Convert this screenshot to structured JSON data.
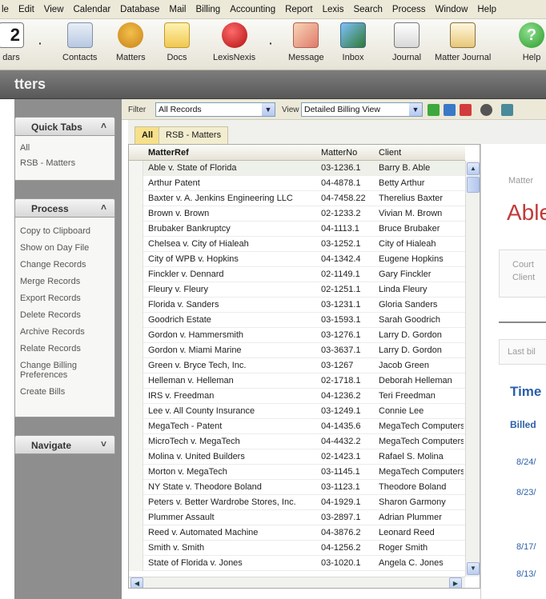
{
  "menu": [
    "le",
    "Edit",
    "View",
    "Calendar",
    "Database",
    "Mail",
    "Billing",
    "Accounting",
    "Report",
    "Lexis",
    "Search",
    "Process",
    "Window",
    "Help"
  ],
  "toolbar": {
    "calendar_label": "dars",
    "contacts_label": "Contacts",
    "matters_label": "Matters",
    "docs_label": "Docs",
    "lexisnexis_label": "LexisNexis",
    "message_label": "Message",
    "inbox_label": "Inbox",
    "journal_label": "Journal",
    "matter_journal_label": "Matter Journal",
    "help_label": "Help",
    "calendar_digit": "2"
  },
  "title": "tters",
  "quick_tabs": {
    "title": "Quick Tabs",
    "items": [
      "All",
      "RSB - Matters"
    ]
  },
  "process": {
    "title": "Process",
    "items": [
      "Copy to Clipboard",
      "Show on Day File",
      "Change Records",
      "Merge Records",
      "Export Records",
      "Delete Records",
      "Archive Records",
      "Relate Records",
      "Change Billing Preferences",
      "Create Bills"
    ]
  },
  "navigate": {
    "title": "Navigate"
  },
  "filter": {
    "filter_label": "Filter",
    "filter_value": "All Records",
    "view_label": "View",
    "view_value": "Detailed Billing View"
  },
  "tabs": [
    "All",
    "RSB - Matters"
  ],
  "grid": {
    "columns": [
      "MatterRef",
      "MatterNo",
      "Client"
    ],
    "rows": [
      [
        "Able v. State of Florida",
        "03-1236.1",
        "Barry B. Able"
      ],
      [
        "Arthur Patent",
        "04-4878.1",
        "Betty Arthur"
      ],
      [
        "Baxter v. A. Jenkins Engineering LLC",
        "04-7458.22",
        "Therelius Baxter"
      ],
      [
        "Brown v. Brown",
        "02-1233.2",
        "Vivian M. Brown"
      ],
      [
        "Brubaker Bankruptcy",
        "04-1113.1",
        "Bruce Brubaker"
      ],
      [
        "Chelsea v. City of Hialeah",
        "03-1252.1",
        "City of Hialeah"
      ],
      [
        "City of WPB v. Hopkins",
        "04-1342.4",
        "Eugene Hopkins"
      ],
      [
        "Finckler v. Dennard",
        "02-1149.1",
        "Gary Finckler"
      ],
      [
        "Fleury v. Fleury",
        "02-1251.1",
        "Linda Fleury"
      ],
      [
        "Florida v. Sanders",
        "03-1231.1",
        "Gloria Sanders"
      ],
      [
        "Goodrich Estate",
        "03-1593.1",
        "Sarah Goodrich"
      ],
      [
        "Gordon v. Hammersmith",
        "03-1276.1",
        "Larry D. Gordon"
      ],
      [
        "Gordon v. Miami Marine",
        "03-3637.1",
        "Larry D. Gordon"
      ],
      [
        "Green v. Bryce Tech, Inc.",
        "03-1267",
        "Jacob Green"
      ],
      [
        "Helleman v. Helleman",
        "02-1718.1",
        "Deborah Helleman"
      ],
      [
        "IRS v. Freedman",
        "04-1236.2",
        "Teri Freedman"
      ],
      [
        "Lee v. All County Insurance",
        "03-1249.1",
        "Connie Lee"
      ],
      [
        "MegaTech - Patent",
        "04-1435.6",
        "MegaTech Computers"
      ],
      [
        "MicroTech v. MegaTech",
        "04-4432.2",
        "MegaTech Computers"
      ],
      [
        "Molina v. United Builders",
        "02-1423.1",
        "Rafael S. Molina"
      ],
      [
        "Morton v. MegaTech",
        "03-1145.1",
        "MegaTech Computers"
      ],
      [
        "NY State v. Theodore Boland",
        "03-1123.1",
        "Theodore Boland"
      ],
      [
        "Peters v. Better Wardrobe Stores, Inc.",
        "04-1929.1",
        "Sharon Garmony"
      ],
      [
        "Plummer Assault",
        "03-2897.1",
        "Adrian Plummer"
      ],
      [
        "Reed v. Automated Machine",
        "04-3876.2",
        "Leonard Reed"
      ],
      [
        "Smith v. Smith",
        "04-1256.2",
        "Roger Smith"
      ],
      [
        "State of Florida v. Jones",
        "03-1020.1",
        "Angela C. Jones"
      ]
    ]
  },
  "detail": {
    "matter_label": "Matter",
    "heading": "Able",
    "court_label": "Court",
    "client_label": "Client",
    "last_bill_label": "Last bil",
    "time_heading": "Time",
    "billed_label": "Billed",
    "dates": [
      "8/24/",
      "8/23/",
      "8/17/",
      "8/13/"
    ]
  }
}
